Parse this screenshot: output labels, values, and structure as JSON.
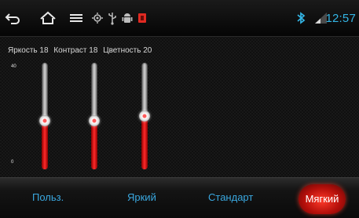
{
  "status_bar": {
    "icons": [
      "back-icon",
      "home-icon",
      "menu-icon",
      "gps-icon",
      "usb-icon",
      "android-debug-icon",
      "notification-icon",
      "bluetooth-icon",
      "signal-icon"
    ],
    "time": "12:57",
    "accent_color": "#33b5e5"
  },
  "labels": {
    "brightness": "Яркость 18",
    "contrast": "Контраст 18",
    "saturation": "Цветность 20"
  },
  "axis": {
    "max": "40",
    "min": "0"
  },
  "sliders": {
    "max": 40,
    "brightness": 18,
    "contrast": 18,
    "saturation": 20
  },
  "presets": {
    "user": "Польз.",
    "bright": "Яркий",
    "standard": "Стандарт",
    "soft": "Мягкий",
    "selected": "Мягкий"
  }
}
